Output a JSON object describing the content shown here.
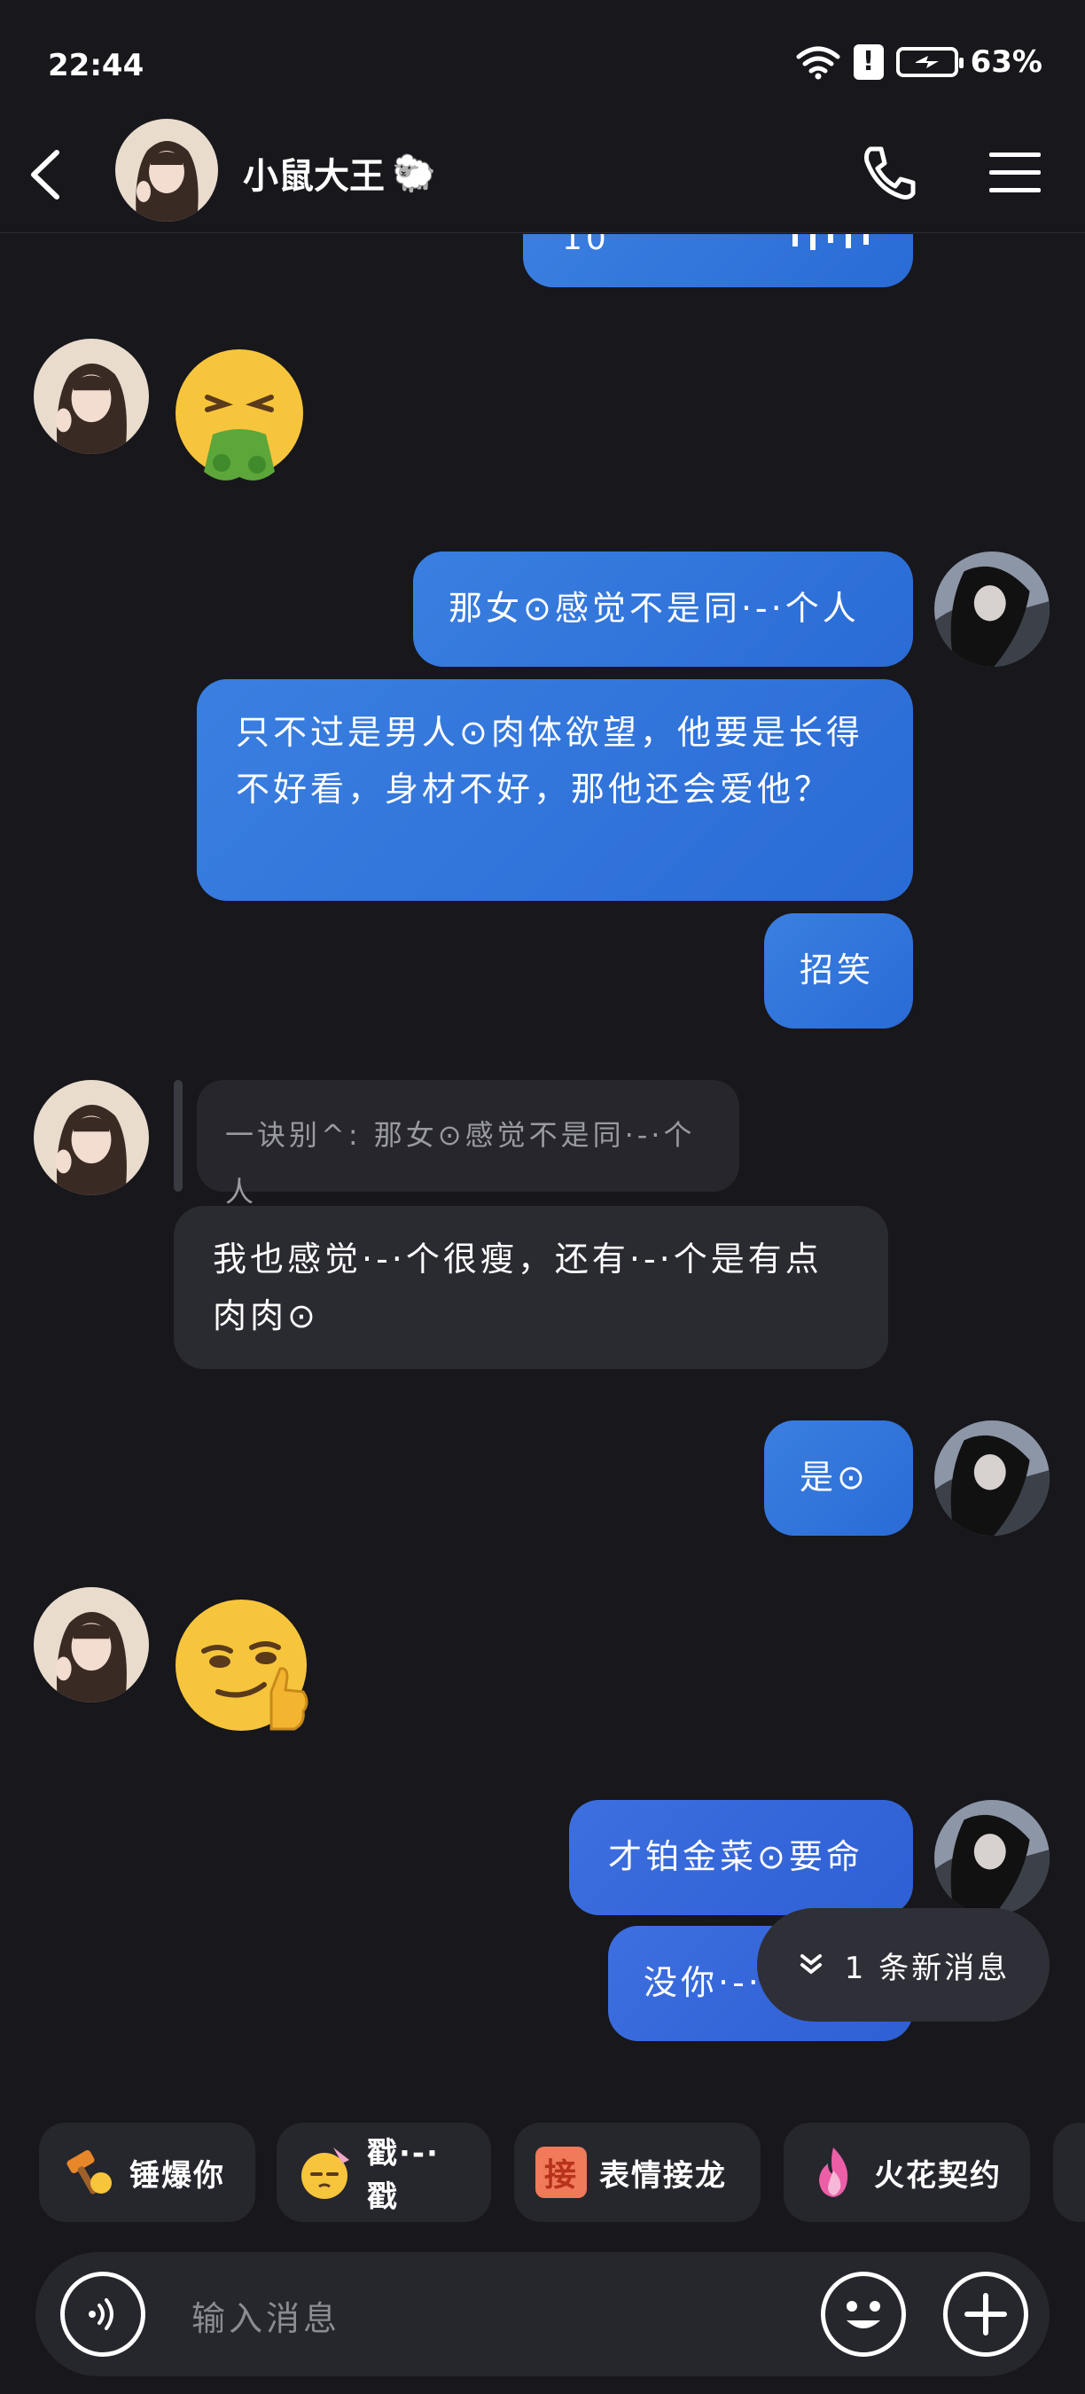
{
  "status_bar": {
    "time": "22:44",
    "battery": "63%"
  },
  "header": {
    "contact_name": "小鼠大王",
    "name_emoji": "🐑"
  },
  "messages": {
    "partial_top": "10",
    "m1_out": "那女⊙感觉不是同·-·个人",
    "m2_out": "只不过是男人⊙肉体欲望，他要是长得不好看，身材不好，那他还会爱他？",
    "m3_out": "招笑",
    "m4_quote": "一诀别^: 那女⊙感觉不是同·-·个人",
    "m4_in": "我也感觉·-·个很瘦，还有·-·个是有点肉肉⊙",
    "m5_out": "是⊙",
    "m6_out": "才铂金菜⊙要命",
    "m7_out_partial": "没你·-·"
  },
  "new_messages": {
    "label": "1 条新消息"
  },
  "quick_actions": [
    {
      "label": "锤爆你",
      "icon": "hammer-icon"
    },
    {
      "label": "戳·-·戳",
      "icon": "poke-icon"
    },
    {
      "label": "表情接龙",
      "icon": "jie-icon",
      "badge": "接"
    },
    {
      "label": "火花契约",
      "icon": "flame-icon"
    }
  ],
  "input": {
    "placeholder": "输入消息"
  },
  "colors": {
    "background": "#17171c",
    "outgoing": "#2f72dd",
    "incoming": "#2a2a31"
  }
}
